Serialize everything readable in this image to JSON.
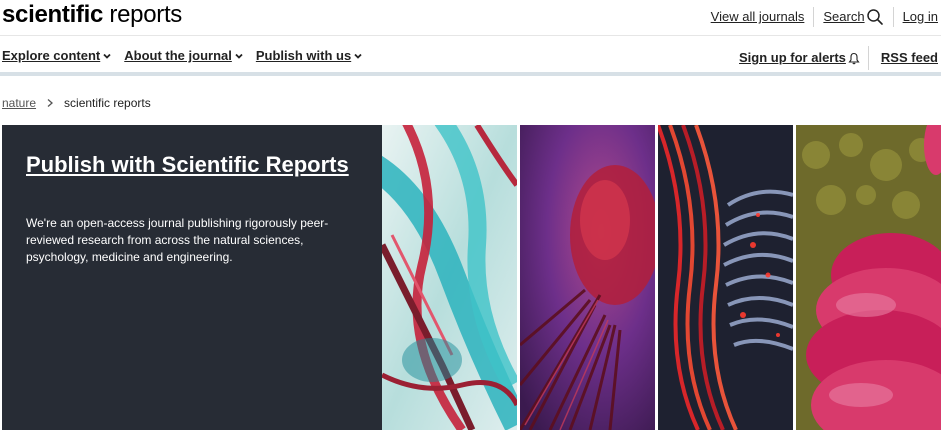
{
  "header": {
    "logo_bold": "scientific",
    "logo_light": " reports",
    "view_all_journals": "View all journals",
    "search_label": "Search",
    "login_label": "Log in"
  },
  "nav": {
    "items": [
      {
        "label": "Explore content"
      },
      {
        "label": "About the journal"
      },
      {
        "label": "Publish with us"
      }
    ],
    "alerts_label": "Sign up for alerts",
    "rss_label": "RSS feed"
  },
  "breadcrumb": {
    "root": "nature",
    "current": "scientific reports"
  },
  "hero": {
    "title": "Publish with Scientific Reports",
    "description": "We're an open-access journal publishing rigorously peer-reviewed research from across the natural sciences, psychology, medicine and engineering."
  },
  "icons": [
    "search-icon",
    "chevron-down-icon",
    "bell-icon",
    "chevron-right-icon"
  ],
  "colors": {
    "hero_background": "#272c35",
    "nav_underline": "#d7e0e6"
  }
}
